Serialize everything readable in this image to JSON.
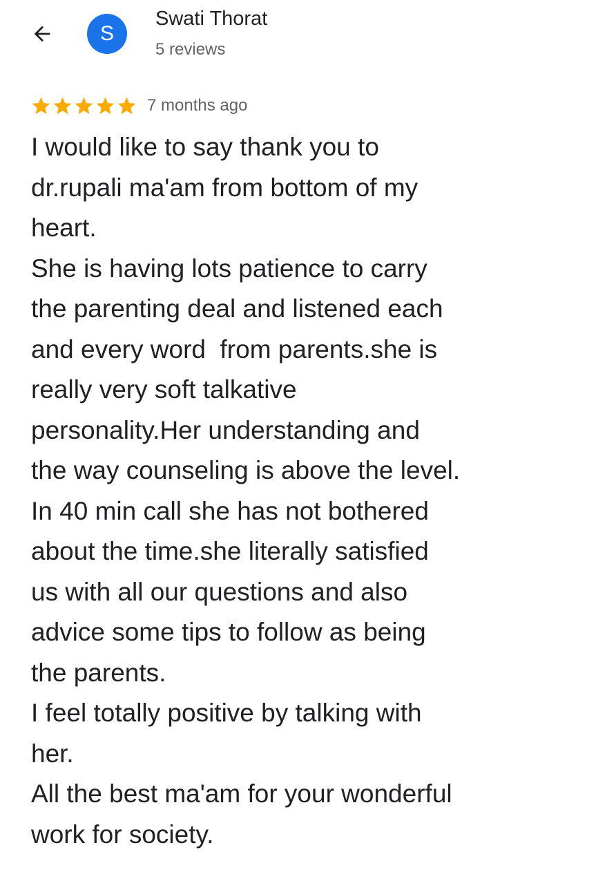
{
  "header": {
    "back_icon": "arrow-back-icon",
    "avatar_letter": "S",
    "avatar_color": "#1a73e8",
    "reviewer_name": "Swati Thorat",
    "review_count": "5 reviews"
  },
  "review": {
    "rating": 5,
    "max_rating": 5,
    "star_icon": "star-icon",
    "star_color": "#f9ab00",
    "date": "7 months ago",
    "lines": [
      "I would like to say thank you to",
      "dr.rupali ma'am from bottom of my",
      "heart.",
      "She is having lots patience to carry",
      "the parenting deal and listened each",
      "and every word  from parents.she is",
      "really very soft talkative",
      "personality.Her understanding and",
      "the way counseling is above the level.",
      "In 40 min call she has not bothered",
      "about the time.she literally satisfied",
      "us with all our questions and also",
      "advice some tips to follow as being",
      "the parents.",
      "I feel totally positive by talking with",
      "her.",
      "All the best ma'am for your wonderful",
      "work for society."
    ]
  }
}
